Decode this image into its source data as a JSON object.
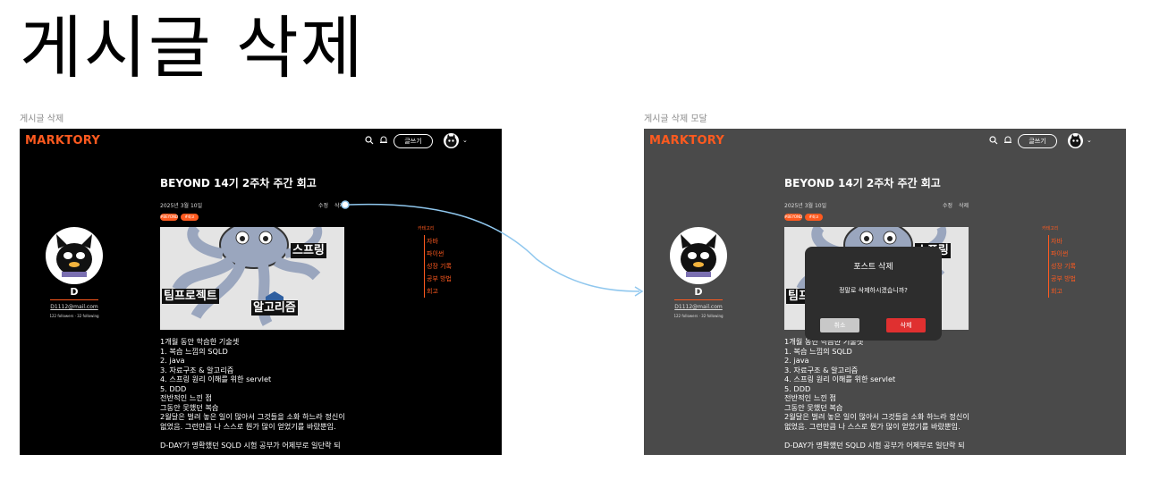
{
  "page_title": "게시글 삭제",
  "frames": {
    "left_label": "게시글 삭제",
    "right_label": "게시글 삭제 모달"
  },
  "app": {
    "logo": "MARKTORY",
    "write_button": "글쓰기",
    "search_icon": "search-icon",
    "bell_icon": "bell-icon",
    "brand_color": "#ff5a1f"
  },
  "post": {
    "title": "BEYOND 14기 2주차 주간 회고",
    "date": "2025년 3월 10일",
    "edit_label": "수정",
    "delete_label": "삭제",
    "tags": [
      "#BEYOND",
      "#회고"
    ],
    "hero_labels": {
      "spring": "스프링",
      "team": "팀프로젝트",
      "algo": "알고리즘"
    },
    "body_lines": [
      "1개월 동안 학습한 기술셋",
      " 1. 복습 느낌의 SQLD",
      " 2. java",
      " 3. 자료구조 & 알고리즘",
      " 4. 스프링 원리 이해를 위한 servlet",
      " 5. DDD",
      "전반적인 느낀 점",
      "그동안 못했던 복습",
      "2월달은 벌려 놓은 일이 많아서 그것들을 소화 하느라 정신이",
      "없었음. 그런만큼 나 스스로 뭔가 많이 얻었기를 바랐뿐임.",
      "",
      "D-DAY가 명확했던 SQLD 시험 공부가 어제부로 일단락 되"
    ]
  },
  "profile": {
    "name": "D",
    "email": "D1112@mail.com",
    "follow": "122 followers · 32 following"
  },
  "toc": {
    "heading": "카테고리",
    "items": [
      "자바",
      "파이썬",
      "성장 기록",
      "공부 방법",
      "회고"
    ]
  },
  "modal": {
    "title": "포스트 삭제",
    "message": "정말로 삭제하시겠습니까?",
    "cancel": "취소",
    "confirm": "삭제"
  }
}
